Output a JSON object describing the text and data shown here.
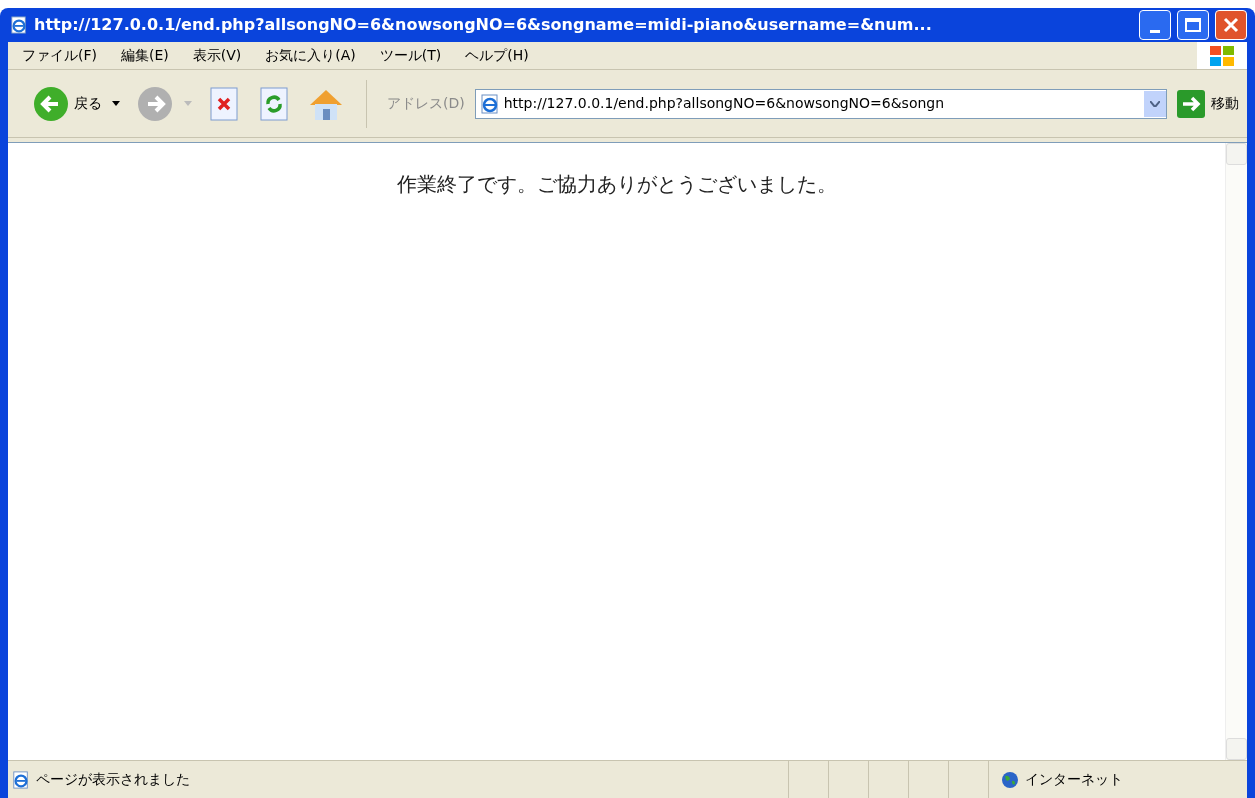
{
  "window": {
    "title": "http://127.0.0.1/end.php?allsongNO=6&nowsongNO=6&songname=midi-piano&username=&num..."
  },
  "menu": [
    "ファイル(F)",
    "編集(E)",
    "表示(V)",
    "お気に入り(A)",
    "ツール(T)",
    "ヘルプ(H)"
  ],
  "toolbar": {
    "back": "戻る",
    "address_label": "アドレス(D)",
    "address": "http://127.0.0.1/end.php?allsongNO=6&nowsongNO=6&songn",
    "go": "移動"
  },
  "content": {
    "message": "作業終了です。ご協力ありがとうございました。"
  },
  "status_bar": {
    "text": "ページが表示されました",
    "zone": "インターネット"
  }
}
